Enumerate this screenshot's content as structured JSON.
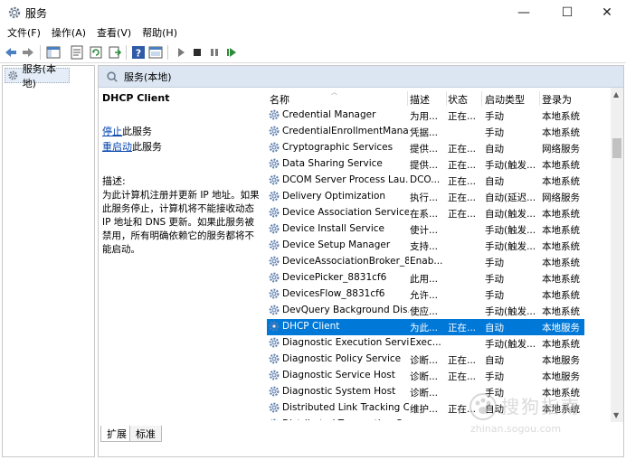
{
  "window": {
    "title": "服务",
    "minimize_glyph": "—",
    "maximize_glyph": "☐",
    "close_glyph": "✕"
  },
  "menu": [
    "文件(F)",
    "操作(A)",
    "查看(V)",
    "帮助(H)"
  ],
  "toolbar_icons": [
    "back-arrow-icon",
    "forward-arrow-icon",
    "show-tree-icon",
    "properties-icon",
    "refresh-icon",
    "export-list-icon",
    "help-icon",
    "console-icon",
    "play-icon",
    "stop-icon",
    "pause-icon",
    "restart-icon"
  ],
  "tree": {
    "item_label": "服务(本地)"
  },
  "pane": {
    "header_label": "服务(本地)"
  },
  "details": {
    "service_name": "DHCP Client",
    "stop_link": "停止",
    "stop_suffix": "此服务",
    "restart_link": "重启动",
    "restart_suffix": "此服务",
    "desc_label": "描述:",
    "desc_text": "为此计算机注册并更新 IP 地址。如果此服务停止，计算机将不能接收动态 IP 地址和 DNS 更新。如果此服务被禁用，所有明确依赖它的服务都将不能启动。"
  },
  "columns": {
    "name": "名称",
    "desc": "描述",
    "status": "状态",
    "startup": "启动类型",
    "logon": "登录为"
  },
  "services": [
    {
      "name": "Credential Manager",
      "desc": "为用...",
      "status": "正在...",
      "startup": "手动",
      "logon": "本地系统",
      "selected": false
    },
    {
      "name": "CredentialEnrollmentMana...",
      "desc": "凭据...",
      "status": "",
      "startup": "手动",
      "logon": "本地系统",
      "selected": false
    },
    {
      "name": "Cryptographic Services",
      "desc": "提供...",
      "status": "正在...",
      "startup": "自动",
      "logon": "网络服务",
      "selected": false
    },
    {
      "name": "Data Sharing Service",
      "desc": "提供...",
      "status": "正在...",
      "startup": "手动(触发...",
      "logon": "本地系统",
      "selected": false
    },
    {
      "name": "DCOM Server Process Lau...",
      "desc": "DCO...",
      "status": "正在...",
      "startup": "自动",
      "logon": "本地系统",
      "selected": false
    },
    {
      "name": "Delivery Optimization",
      "desc": "执行...",
      "status": "正在...",
      "startup": "自动(延迟...",
      "logon": "网络服务",
      "selected": false
    },
    {
      "name": "Device Association Service",
      "desc": "在系...",
      "status": "正在...",
      "startup": "自动(触发...",
      "logon": "本地系统",
      "selected": false
    },
    {
      "name": "Device Install Service",
      "desc": "使计...",
      "status": "",
      "startup": "手动(触发...",
      "logon": "本地系统",
      "selected": false
    },
    {
      "name": "Device Setup Manager",
      "desc": "支持...",
      "status": "",
      "startup": "手动(触发...",
      "logon": "本地系统",
      "selected": false
    },
    {
      "name": "DeviceAssociationBroker_8...",
      "desc": "Enab...",
      "status": "",
      "startup": "手动",
      "logon": "本地系统",
      "selected": false
    },
    {
      "name": "DevicePicker_8831cf6",
      "desc": "此用...",
      "status": "",
      "startup": "手动",
      "logon": "本地系统",
      "selected": false
    },
    {
      "name": "DevicesFlow_8831cf6",
      "desc": "允许...",
      "status": "",
      "startup": "手动",
      "logon": "本地系统",
      "selected": false
    },
    {
      "name": "DevQuery Background Dis...",
      "desc": "使应...",
      "status": "",
      "startup": "手动(触发...",
      "logon": "本地系统",
      "selected": false
    },
    {
      "name": "DHCP Client",
      "desc": "为此...",
      "status": "正在...",
      "startup": "自动",
      "logon": "本地服务",
      "selected": true
    },
    {
      "name": "Diagnostic Execution Service",
      "desc": "Exec...",
      "status": "",
      "startup": "手动(触发...",
      "logon": "本地系统",
      "selected": false
    },
    {
      "name": "Diagnostic Policy Service",
      "desc": "诊断...",
      "status": "正在...",
      "startup": "自动",
      "logon": "本地服务",
      "selected": false
    },
    {
      "name": "Diagnostic Service Host",
      "desc": "诊断...",
      "status": "正在...",
      "startup": "手动",
      "logon": "本地服务",
      "selected": false
    },
    {
      "name": "Diagnostic System Host",
      "desc": "诊断...",
      "status": "",
      "startup": "手动",
      "logon": "本地系统",
      "selected": false
    },
    {
      "name": "Distributed Link Tracking C...",
      "desc": "维护...",
      "status": "正在...",
      "startup": "自动",
      "logon": "本地系统",
      "selected": false
    },
    {
      "name": "Distributed Transaction Co...",
      "desc": "协调...",
      "status": "",
      "startup": "手动",
      "logon": "网络服务",
      "selected": false
    }
  ],
  "tabs": [
    "扩展",
    "标准"
  ],
  "watermark": {
    "line1": "搜狗指南",
    "line2": "zhinan.sogou.com"
  },
  "colors": {
    "selection": "#0078d7",
    "header_band": "#dce6f2",
    "link": "#0645ad"
  }
}
